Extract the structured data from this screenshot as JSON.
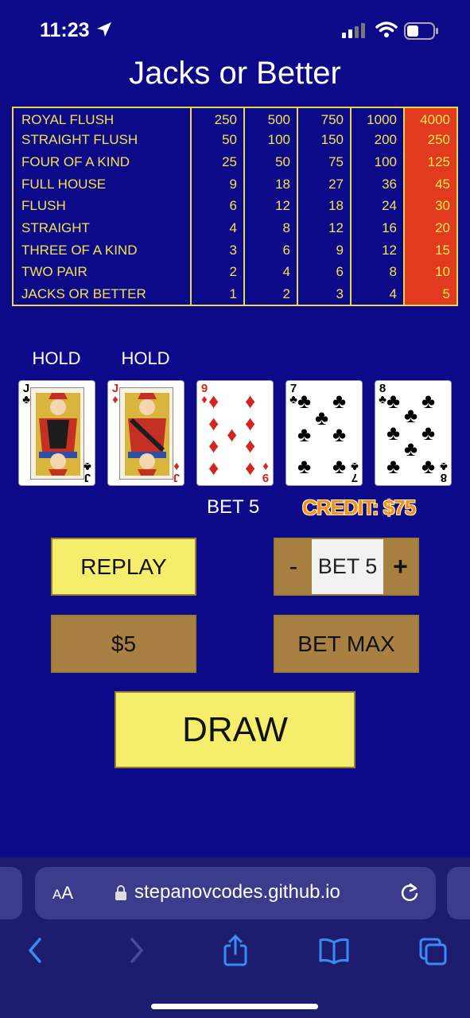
{
  "status": {
    "time": "11:23"
  },
  "title": "Jacks or Better",
  "paytable": [
    {
      "hand": "ROYAL FLUSH",
      "pays": [
        "250",
        "500",
        "750",
        "1000",
        "4000"
      ]
    },
    {
      "hand": "STRAIGHT FLUSH",
      "pays": [
        "50",
        "100",
        "150",
        "200",
        "250"
      ]
    },
    {
      "hand": "FOUR OF A KIND",
      "pays": [
        "25",
        "50",
        "75",
        "100",
        "125"
      ]
    },
    {
      "hand": "FULL HOUSE",
      "pays": [
        "9",
        "18",
        "27",
        "36",
        "45"
      ]
    },
    {
      "hand": "FLUSH",
      "pays": [
        "6",
        "12",
        "18",
        "24",
        "30"
      ]
    },
    {
      "hand": "STRAIGHT",
      "pays": [
        "4",
        "8",
        "12",
        "16",
        "20"
      ]
    },
    {
      "hand": "THREE OF A KIND",
      "pays": [
        "3",
        "6",
        "9",
        "12",
        "15"
      ]
    },
    {
      "hand": "TWO PAIR",
      "pays": [
        "2",
        "4",
        "6",
        "8",
        "10"
      ]
    },
    {
      "hand": "JACKS OR BETTER",
      "pays": [
        "1",
        "2",
        "3",
        "4",
        "5"
      ]
    }
  ],
  "holds": [
    "HOLD",
    "HOLD"
  ],
  "cards": [
    {
      "rank": "J",
      "suit": "♣",
      "color": "black",
      "held": true
    },
    {
      "rank": "J",
      "suit": "♦",
      "color": "red",
      "held": true
    },
    {
      "rank": "9",
      "suit": "♦",
      "color": "red",
      "held": false
    },
    {
      "rank": "7",
      "suit": "♣",
      "color": "black",
      "held": false
    },
    {
      "rank": "8",
      "suit": "♣",
      "color": "black",
      "held": false
    }
  ],
  "bet_label": "BET 5",
  "credit_label": "CREDIT: $75",
  "buttons": {
    "replay": "REPLAY",
    "stepper_minus": "-",
    "stepper_value": "BET 5",
    "stepper_plus": "+",
    "denomination": "$5",
    "bet_max": "BET MAX",
    "draw": "DRAW"
  },
  "browser": {
    "text_size_small": "A",
    "text_size_large": "A",
    "url": "stepanovcodes.github.io"
  },
  "colors": {
    "background": "#0d0a8a",
    "paytable_text": "#f3e34e",
    "highlight_column": "#e13a1f",
    "button_yellow": "#f4ee6a",
    "button_gold": "#a88142"
  }
}
